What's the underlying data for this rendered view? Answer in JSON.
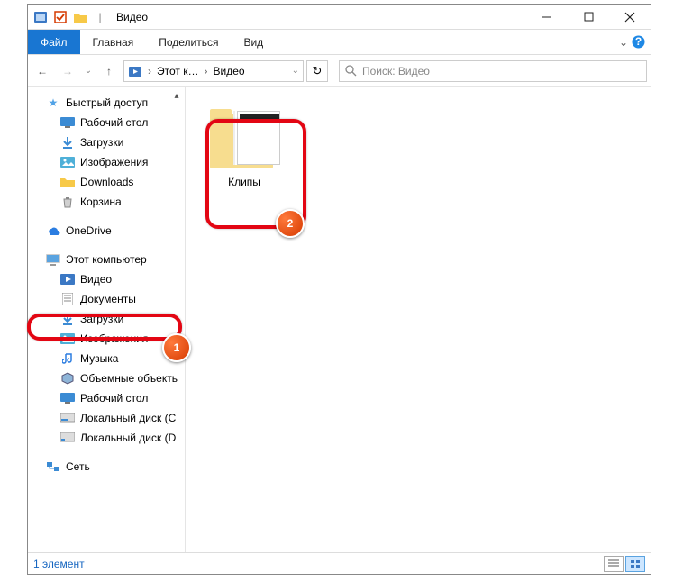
{
  "window": {
    "title": "Видео"
  },
  "qat": {
    "icon1": "video-library-icon",
    "icon2": "checkbox-icon",
    "icon3": "folder-icon",
    "icon4": "divider-icon"
  },
  "ribbon": {
    "file": "Файл",
    "tabs": [
      "Главная",
      "Поделиться",
      "Вид"
    ]
  },
  "nav": {
    "back": "←",
    "forward": "→",
    "up": "↑",
    "breadcrumb": [
      "Этот к…",
      "Видео"
    ],
    "refresh": "⟳"
  },
  "search": {
    "placeholder": "Поиск: Видео"
  },
  "sidebar": {
    "quick_access": "Быстрый доступ",
    "quick_items": [
      "Рабочий стол",
      "Загрузки",
      "Изображения",
      "Downloads",
      "Корзина"
    ],
    "onedrive": "OneDrive",
    "this_pc": "Этот компьютер",
    "pc_items": [
      "Видео",
      "Документы",
      "Загрузки",
      "Изображения",
      "Музыка",
      "Объемные объекть",
      "Рабочий стол",
      "Локальный диск (C",
      "Локальный диск (D"
    ],
    "network": "Сеть"
  },
  "content": {
    "folders": [
      {
        "name": "Клипы"
      }
    ]
  },
  "statusbar": {
    "count": "1 элемент"
  },
  "annotations": {
    "badge1": "1",
    "badge2": "2"
  }
}
